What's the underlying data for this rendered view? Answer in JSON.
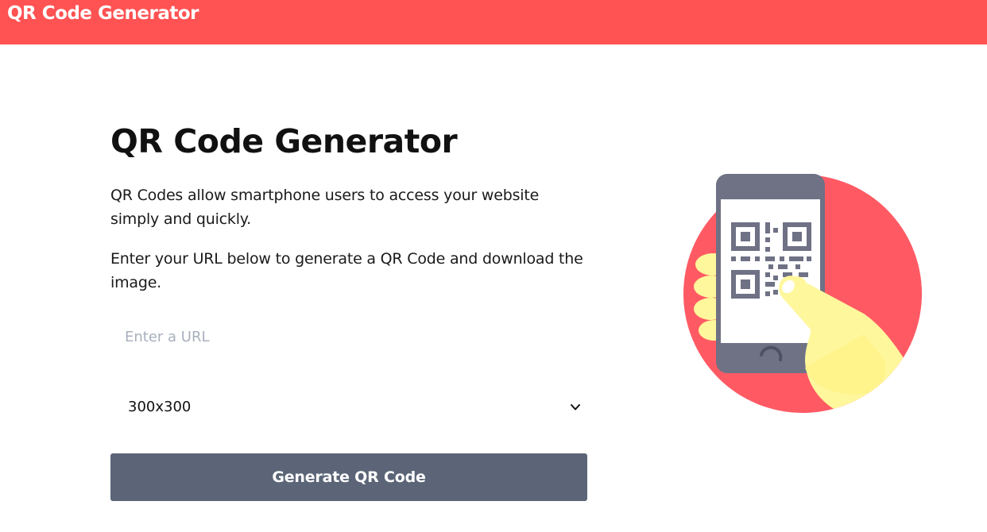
{
  "navbar": {
    "brand": "QR Code Generator"
  },
  "main": {
    "title": "QR Code Generator",
    "paragraph_1": "QR Codes allow smartphone users to access your website simply and quickly.",
    "paragraph_2": "Enter your URL below to generate a QR Code and download the image."
  },
  "form": {
    "url_input": {
      "value": "",
      "placeholder": "Enter a URL"
    },
    "size_select": {
      "selected": "300x300"
    },
    "generate_button_label": "Generate QR Code"
  },
  "colors": {
    "brand_red": "#ff5253",
    "button_slate": "#5b6577",
    "phone_gray": "#6f7185",
    "hand_yellow": "#fff79c",
    "circle_red": "#ff5a64"
  },
  "icons": {
    "select_chevron": "chevron-down-icon",
    "illustration": "phone-qr-scan-illustration"
  }
}
